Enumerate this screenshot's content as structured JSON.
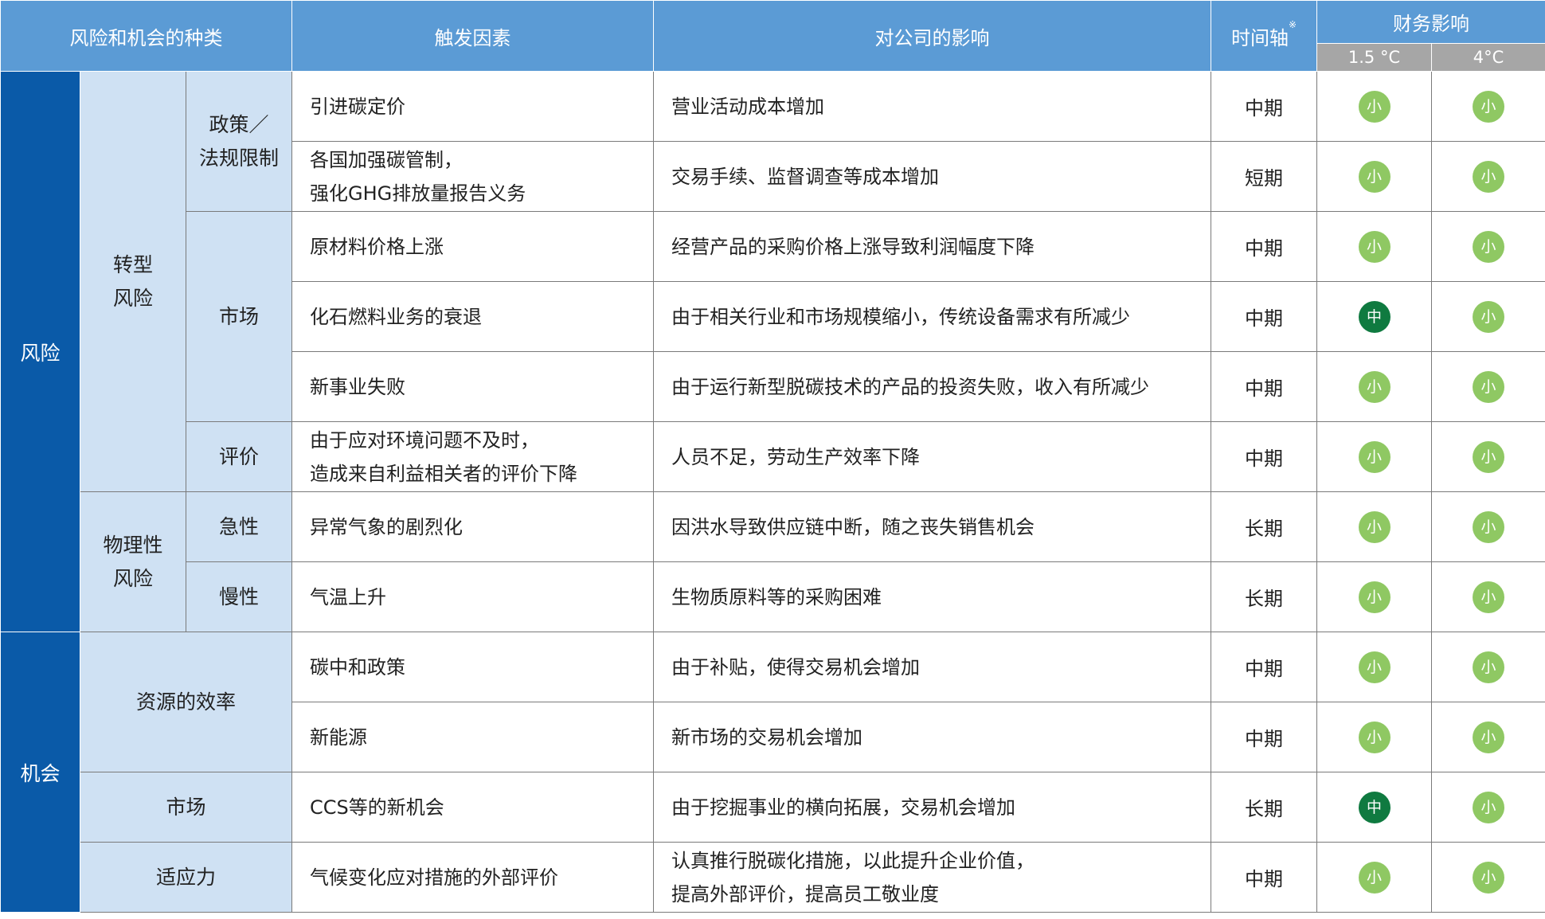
{
  "header": {
    "col_type": "风险和机会的种类",
    "col_trigger": "触发因素",
    "col_impact": "对公司的影响",
    "col_time": "时间轴",
    "col_time_mark": "※",
    "col_financial": "财务影响",
    "col_15c": "1.5 °C",
    "col_4c": "4°C"
  },
  "categories": {
    "risk": "风险",
    "opportunity": "机会",
    "transition_risk": "转型\n风险",
    "physical_risk": "物理性\n风险",
    "resource_efficiency": "资源的效率",
    "opp_market": "市场",
    "resilience": "适应力",
    "policy_law": "政策／\n法规限制",
    "market": "市场",
    "reputation": "评价",
    "acute": "急性",
    "chronic": "慢性"
  },
  "rows": [
    {
      "trigger": "引进碳定价",
      "impact": "营业活动成本增加",
      "time": "中期",
      "impact_15c": "小",
      "impact_4c": "小"
    },
    {
      "trigger": "各国加强碳管制，\n强化GHG排放量报告义务",
      "impact": "交易手续、监督调查等成本增加",
      "time": "短期",
      "impact_15c": "小",
      "impact_4c": "小"
    },
    {
      "trigger": "原材料价格上涨",
      "impact": "经营产品的采购价格上涨导致利润幅度下降",
      "time": "中期",
      "impact_15c": "小",
      "impact_4c": "小"
    },
    {
      "trigger": "化石燃料业务的衰退",
      "impact": "由于相关行业和市场规模缩小，传统设备需求有所减少",
      "time": "中期",
      "impact_15c": "中",
      "impact_4c": "小"
    },
    {
      "trigger": "新事业失败",
      "impact": "由于运行新型脱碳技术的产品的投资失败，收入有所减少",
      "time": "中期",
      "impact_15c": "小",
      "impact_4c": "小"
    },
    {
      "trigger": "由于应对环境问题不及时，\n造成来自利益相关者的评价下降",
      "impact": "人员不足，劳动生产效率下降",
      "time": "中期",
      "impact_15c": "小",
      "impact_4c": "小"
    },
    {
      "trigger": "异常气象的剧烈化",
      "impact": "因洪水导致供应链中断，随之丧失销售机会",
      "time": "长期",
      "impact_15c": "小",
      "impact_4c": "小"
    },
    {
      "trigger": "气温上升",
      "impact": "生物质原料等的采购困难",
      "time": "长期",
      "impact_15c": "小",
      "impact_4c": "小"
    },
    {
      "trigger": "碳中和政策",
      "impact": "由于补贴，使得交易机会增加",
      "time": "中期",
      "impact_15c": "小",
      "impact_4c": "小"
    },
    {
      "trigger": "新能源",
      "impact": "新市场的交易机会增加",
      "time": "中期",
      "impact_15c": "小",
      "impact_4c": "小"
    },
    {
      "trigger": "CCS等的新机会",
      "impact": "由于挖掘事业的横向拓展，交易机会增加",
      "time": "长期",
      "impact_15c": "中",
      "impact_4c": "小"
    },
    {
      "trigger": "气候变化应对措施的外部评价",
      "impact": "认真推行脱碳化措施，以此提升企业价值，\n提高外部评价，提高员工敬业度",
      "time": "中期",
      "impact_15c": "小",
      "impact_4c": "小"
    }
  ],
  "colors": {
    "header_blue": "#5b9bd5",
    "category_dark_blue": "#0a5aa8",
    "category_light_blue": "#cfe1f3",
    "subheader_gray": "#a6a6a6",
    "badge_small_green": "#8fc863",
    "badge_medium_green": "#0f7a40"
  }
}
